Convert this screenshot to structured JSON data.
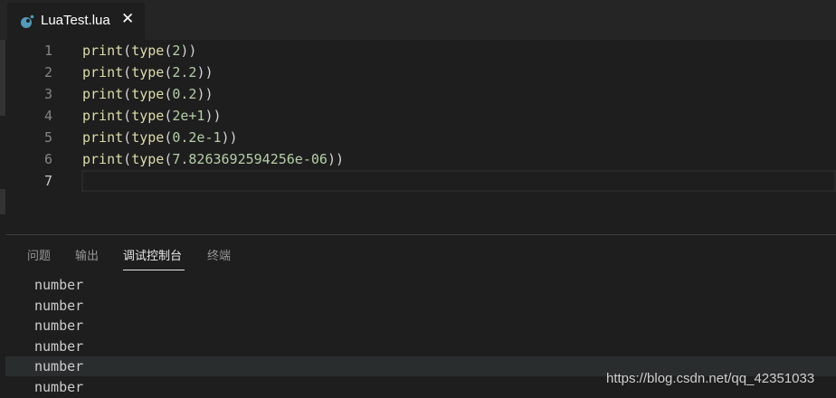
{
  "tab": {
    "filename": "LuaTest.lua",
    "close_glyph": "✕",
    "icon": "lua-icon",
    "icon_color": "#519aba"
  },
  "editor": {
    "lines": [
      {
        "number": "1",
        "fn1": "print",
        "p1": "(",
        "fn2": "type",
        "p2": "(",
        "num": "2",
        "p3": "))"
      },
      {
        "number": "2",
        "fn1": "print",
        "p1": "(",
        "fn2": "type",
        "p2": "(",
        "num": "2.2",
        "p3": "))"
      },
      {
        "number": "3",
        "fn1": "print",
        "p1": "(",
        "fn2": "type",
        "p2": "(",
        "num": "0.2",
        "p3": "))"
      },
      {
        "number": "4",
        "fn1": "print",
        "p1": "(",
        "fn2": "type",
        "p2": "(",
        "num": "2e+1",
        "p3": "))"
      },
      {
        "number": "5",
        "fn1": "print",
        "p1": "(",
        "fn2": "type",
        "p2": "(",
        "num": "0.2e-1",
        "p3": "))"
      },
      {
        "number": "6",
        "fn1": "print",
        "p1": "(",
        "fn2": "type",
        "p2": "(",
        "num": "7.8263692594256e-06",
        "p3": "))"
      }
    ],
    "current_line_number": "7"
  },
  "panel": {
    "tabs": [
      "问题",
      "输出",
      "调试控制台",
      "终端"
    ],
    "active_tab": "调试控制台",
    "output": [
      "number",
      "number",
      "number",
      "number",
      "number",
      "number"
    ]
  },
  "watermark": "https://blog.csdn.net/qq_42351033"
}
